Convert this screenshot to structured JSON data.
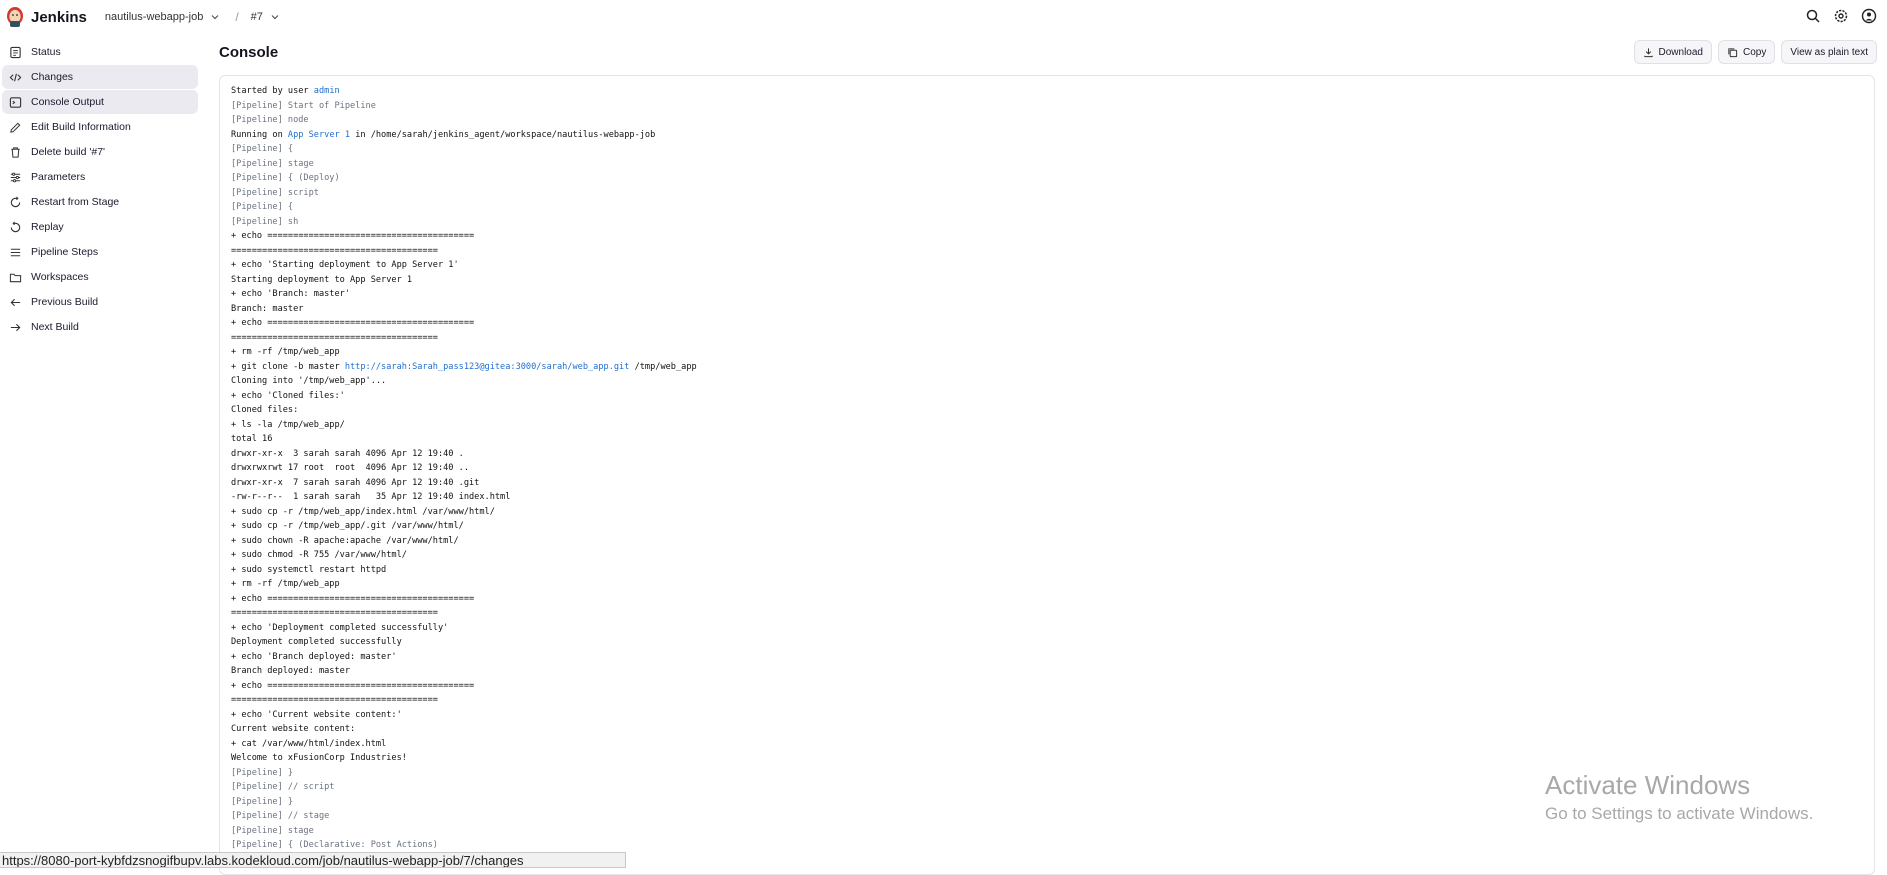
{
  "header": {
    "brand": "Jenkins",
    "crumbs": [
      "nautilus-webapp-job",
      "#7"
    ]
  },
  "sidebar": {
    "items": [
      {
        "label": "Status",
        "icon": "status-icon"
      },
      {
        "label": "Changes",
        "icon": "code-icon"
      },
      {
        "label": "Console Output",
        "icon": "terminal-icon"
      },
      {
        "label": "Edit Build Information",
        "icon": "edit-icon"
      },
      {
        "label": "Delete build '#7'",
        "icon": "trash-icon"
      },
      {
        "label": "Parameters",
        "icon": "sliders-icon"
      },
      {
        "label": "Restart from Stage",
        "icon": "restart-icon"
      },
      {
        "label": "Replay",
        "icon": "replay-icon"
      },
      {
        "label": "Pipeline Steps",
        "icon": "steps-icon"
      },
      {
        "label": "Workspaces",
        "icon": "folder-icon"
      },
      {
        "label": "Previous Build",
        "icon": "arrow-left-icon"
      },
      {
        "label": "Next Build",
        "icon": "arrow-right-icon"
      }
    ]
  },
  "main": {
    "title": "Console",
    "buttons": {
      "download": "Download",
      "copy": "Copy",
      "plain": "View as plain text"
    }
  },
  "console": {
    "lines": [
      [
        "Started by user ",
        {
          "link": "admin"
        }
      ],
      [
        {
          "pl": "[Pipeline] Start of Pipeline"
        }
      ],
      [
        {
          "pl": "[Pipeline] node"
        }
      ],
      [
        "Running on ",
        {
          "link": "App Server 1"
        },
        " in /home/sarah/jenkins_agent/workspace/nautilus-webapp-job"
      ],
      [
        {
          "pl": "[Pipeline] {"
        }
      ],
      [
        {
          "pl": "[Pipeline] stage"
        }
      ],
      [
        {
          "pl": "[Pipeline] { (Deploy)"
        }
      ],
      [
        {
          "pl": "[Pipeline] script"
        }
      ],
      [
        {
          "pl": "[Pipeline] {"
        }
      ],
      [
        {
          "pl": "[Pipeline] sh"
        }
      ],
      [
        "+ echo ========================================"
      ],
      [
        "========================================"
      ],
      [
        "+ echo 'Starting deployment to App Server 1'"
      ],
      [
        "Starting deployment to App Server 1"
      ],
      [
        "+ echo 'Branch: master'"
      ],
      [
        "Branch: master"
      ],
      [
        "+ echo ========================================"
      ],
      [
        "========================================"
      ],
      [
        "+ rm -rf /tmp/web_app"
      ],
      [
        "+ git clone -b master ",
        {
          "link": "http://sarah:Sarah_pass123@gitea:3000/sarah/web_app.git"
        },
        " /tmp/web_app"
      ],
      [
        "Cloning into '/tmp/web_app'..."
      ],
      [
        "+ echo 'Cloned files:'"
      ],
      [
        "Cloned files:"
      ],
      [
        "+ ls -la /tmp/web_app/"
      ],
      [
        "total 16"
      ],
      [
        "drwxr-xr-x  3 sarah sarah 4096 Apr 12 19:40 ."
      ],
      [
        "drwxrwxrwt 17 root  root  4096 Apr 12 19:40 .."
      ],
      [
        "drwxr-xr-x  7 sarah sarah 4096 Apr 12 19:40 .git"
      ],
      [
        "-rw-r--r--  1 sarah sarah   35 Apr 12 19:40 index.html"
      ],
      [
        "+ sudo cp -r /tmp/web_app/index.html /var/www/html/"
      ],
      [
        "+ sudo cp -r /tmp/web_app/.git /var/www/html/"
      ],
      [
        "+ sudo chown -R apache:apache /var/www/html/"
      ],
      [
        "+ sudo chmod -R 755 /var/www/html/"
      ],
      [
        "+ sudo systemctl restart httpd"
      ],
      [
        "+ rm -rf /tmp/web_app"
      ],
      [
        "+ echo ========================================"
      ],
      [
        "========================================"
      ],
      [
        "+ echo 'Deployment completed successfully'"
      ],
      [
        "Deployment completed successfully"
      ],
      [
        "+ echo 'Branch deployed: master'"
      ],
      [
        "Branch deployed: master"
      ],
      [
        "+ echo ========================================"
      ],
      [
        "========================================"
      ],
      [
        "+ echo 'Current website content:'"
      ],
      [
        "Current website content:"
      ],
      [
        "+ cat /var/www/html/index.html"
      ],
      [
        "Welcome to xFusionCorp Industries!"
      ],
      [
        {
          "pl": "[Pipeline] }"
        }
      ],
      [
        {
          "pl": "[Pipeline] // script"
        }
      ],
      [
        {
          "pl": "[Pipeline] }"
        }
      ],
      [
        {
          "pl": "[Pipeline] // stage"
        }
      ],
      [
        {
          "pl": "[Pipeline] stage"
        }
      ],
      [
        {
          "pl": "[Pipeline] { (Declarative: Post Actions)"
        }
      ]
    ]
  },
  "watermark": {
    "title": "Activate Windows",
    "subtitle": "Go to Settings to activate Windows."
  },
  "statusbar": {
    "url": "https://8080-port-kybfdzsnogifbupv.labs.kodekloud.com/job/nautilus-webapp-job/7/changes"
  }
}
